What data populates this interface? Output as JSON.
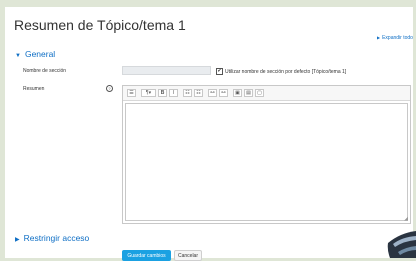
{
  "page": {
    "title": "Resumen de Tópico/tema 1"
  },
  "expand_all": "Expandir todo",
  "sections": {
    "general": "General",
    "restrict": "Restringir acceso"
  },
  "form": {
    "section_name_label": "Nombre de sección",
    "section_name_value": "",
    "use_default_label": "Utilizar nombre de sección por defecto [Tópico/tema 1]",
    "use_default_checked": true,
    "summary_label": "Resumen",
    "help_icon": "?"
  },
  "editor": {
    "toolbar": [
      {
        "id": "expand",
        "icon": "☰"
      },
      {
        "id": "style",
        "icon": "¶▾"
      },
      {
        "id": "bold",
        "icon": "B"
      },
      {
        "id": "italic",
        "icon": "I"
      },
      {
        "id": "bullet-list",
        "icon": "☷"
      },
      {
        "id": "number-list",
        "icon": "☷"
      },
      {
        "id": "link",
        "icon": "⚯"
      },
      {
        "id": "unlink",
        "icon": "⚯"
      },
      {
        "id": "image",
        "icon": "▣"
      },
      {
        "id": "media",
        "icon": "▤"
      },
      {
        "id": "file",
        "icon": "▢"
      }
    ],
    "content": ""
  },
  "buttons": {
    "save": "Guardar cambios",
    "cancel": "Cancelar"
  },
  "colors": {
    "link": "#0f6fc5",
    "primary": "#1ba1e2",
    "background": "#dfe6d6"
  }
}
